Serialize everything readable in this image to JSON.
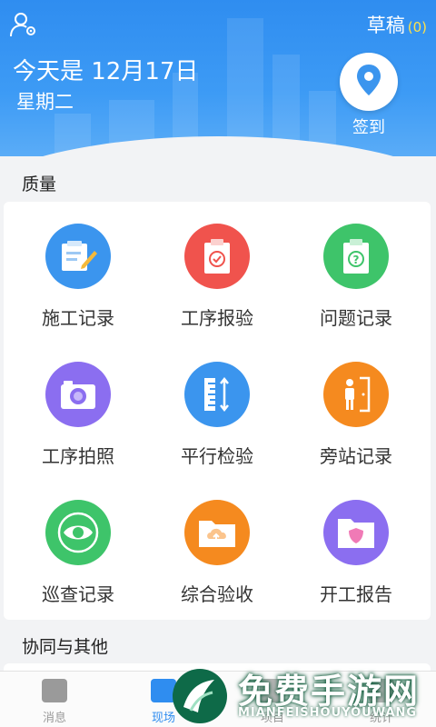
{
  "header": {
    "draft_label": "草稿",
    "draft_count": "(0)",
    "date": "今天是 12月17日",
    "weekday": "星期二",
    "signin_label": "签到"
  },
  "quality": {
    "title": "质量",
    "items": [
      {
        "label": "施工记录",
        "color": "#3b95ee",
        "icon": "edit-note-icon"
      },
      {
        "label": "工序报验",
        "color": "#f0534d",
        "icon": "checklist-icon"
      },
      {
        "label": "问题记录",
        "color": "#3ec46a",
        "icon": "question-icon"
      },
      {
        "label": "工序拍照",
        "color": "#8b6ef0",
        "icon": "camera-icon"
      },
      {
        "label": "平行检验",
        "color": "#3b95ee",
        "icon": "ruler-icon"
      },
      {
        "label": "旁站记录",
        "color": "#f58a1f",
        "icon": "person-door-icon"
      },
      {
        "label": "巡查记录",
        "color": "#3ec46a",
        "icon": "eye-icon"
      },
      {
        "label": "综合验收",
        "color": "#f58a1f",
        "icon": "folder-upload-icon"
      },
      {
        "label": "开工报告",
        "color": "#8b6ef0",
        "icon": "folder-shield-icon"
      }
    ]
  },
  "collab": {
    "title": "协同与其他"
  },
  "tabbar": {
    "tabs": [
      {
        "label": "消息"
      },
      {
        "label": "现场"
      },
      {
        "label": "项目"
      },
      {
        "label": "统计"
      }
    ]
  },
  "watermark": {
    "title": "免费手游网",
    "sub": "MIANFEISHOUYOUWANG"
  }
}
